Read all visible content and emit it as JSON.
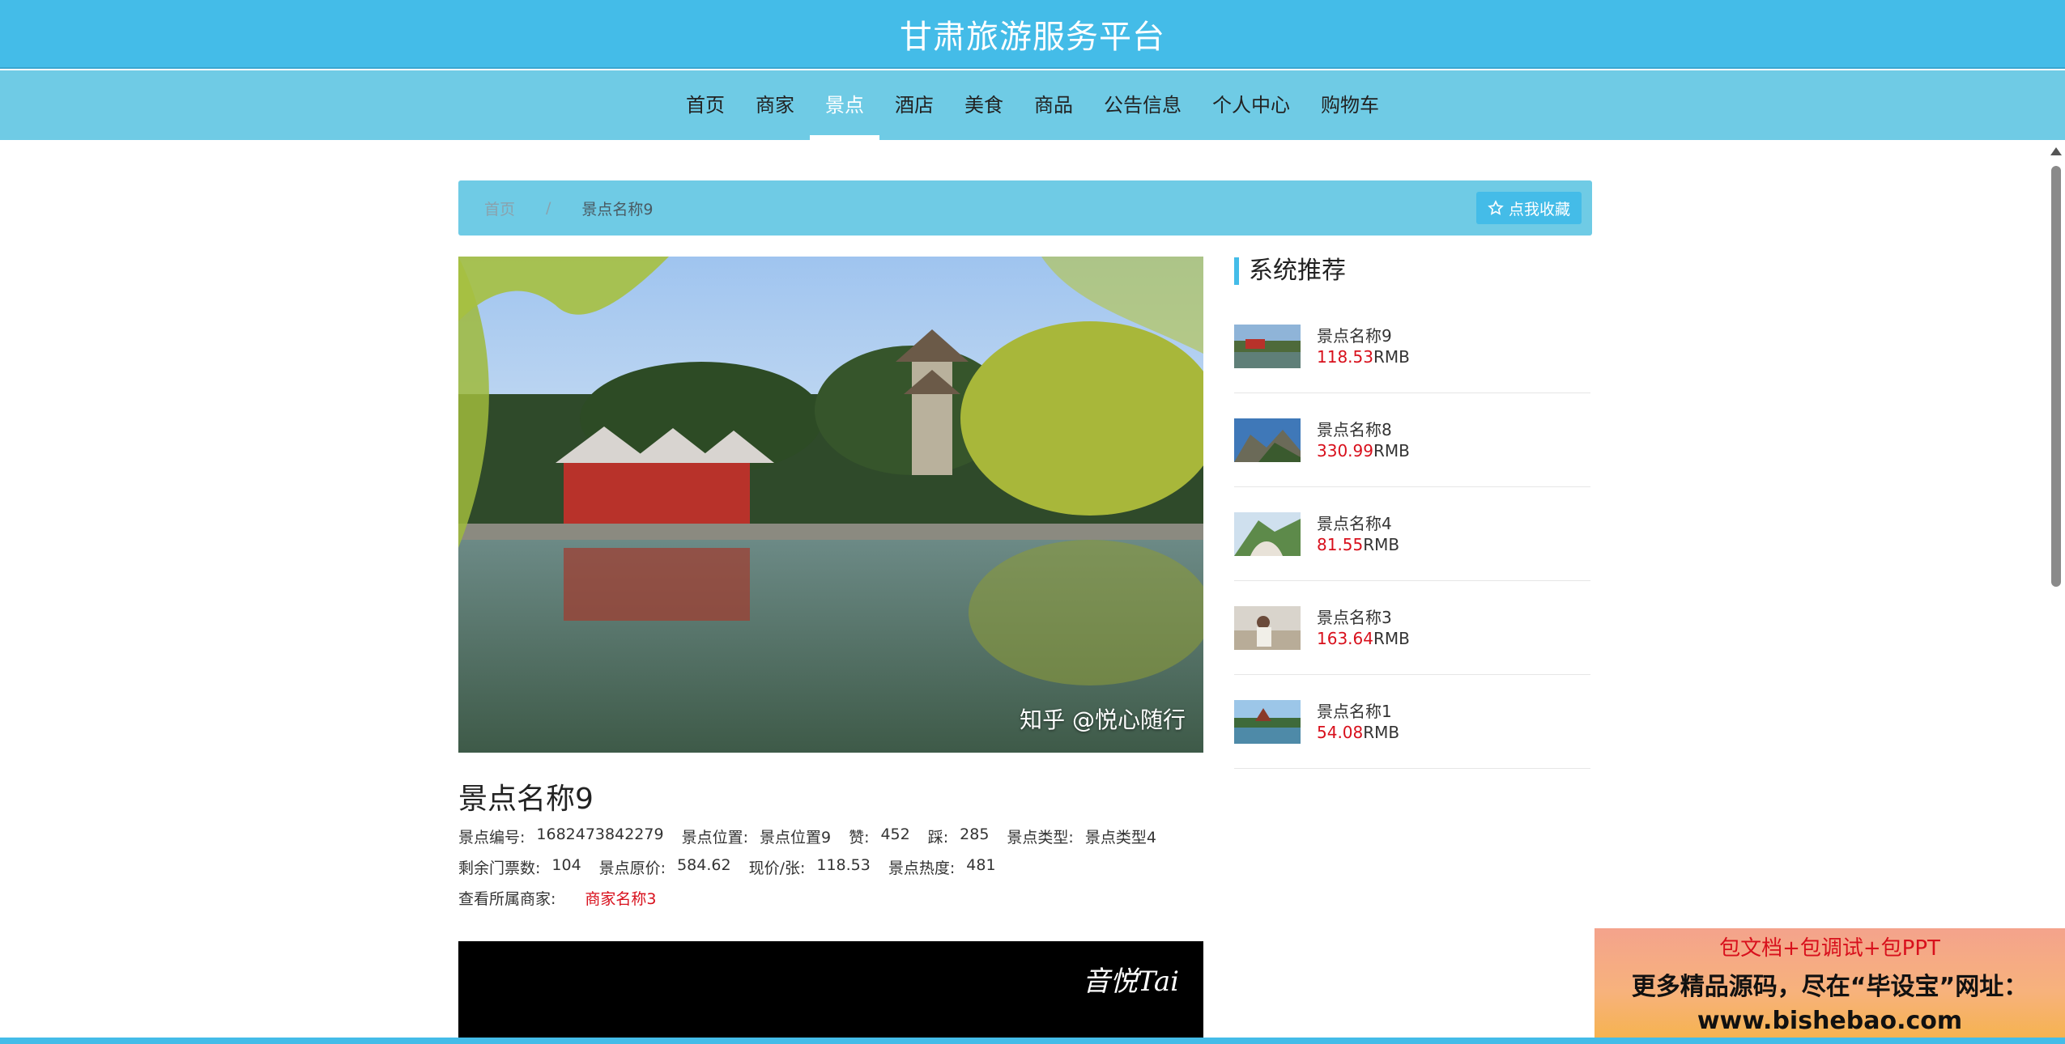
{
  "site": {
    "title": "甘肃旅游服务平台"
  },
  "nav": {
    "items": [
      "首页",
      "商家",
      "景点",
      "酒店",
      "美食",
      "商品",
      "公告信息",
      "个人中心",
      "购物车"
    ],
    "active_index": 2
  },
  "breadcrumb": {
    "home": "首页",
    "separator": "/",
    "current": "景点名称9",
    "favorite_label": "点我收藏"
  },
  "detail": {
    "title": "景点名称9",
    "watermark": "知乎 @悦心随行",
    "fields": {
      "code_label": "景点编号:",
      "code_value": "1682473842279",
      "location_label": "景点位置:",
      "location_value": "景点位置9",
      "like_label": "赞:",
      "like_value": "452",
      "dislike_label": "踩:",
      "dislike_value": "285",
      "type_label": "景点类型:",
      "type_value": "景点类型4",
      "tickets_label": "剩余门票数:",
      "tickets_value": "104",
      "orig_price_label": "景点原价:",
      "orig_price_value": "584.62",
      "cur_price_label": "现价/张:",
      "cur_price_value": "118.53",
      "heat_label": "景点热度:",
      "heat_value": "481",
      "merchant_label": "查看所属商家:",
      "merchant_value": "商家名称3"
    },
    "video_logo": "音悦Tai"
  },
  "recommend": {
    "title": "系统推荐",
    "items": [
      {
        "name": "景点名称9",
        "price": "118.53",
        "unit": "RMB"
      },
      {
        "name": "景点名称8",
        "price": "330.99",
        "unit": "RMB"
      },
      {
        "name": "景点名称4",
        "price": "81.55",
        "unit": "RMB"
      },
      {
        "name": "景点名称3",
        "price": "163.64",
        "unit": "RMB"
      },
      {
        "name": "景点名称1",
        "price": "54.08",
        "unit": "RMB"
      }
    ]
  },
  "ad": {
    "line1": "包文档+包调试+包PPT",
    "line2": "更多精品源码，尽在“毕设宝”网址：",
    "line3": "www.bishebao.com"
  },
  "colors": {
    "primary": "#44bce8",
    "nav_bg": "#6fcbe5",
    "price_red": "#d8101c"
  },
  "icons": [
    "star-icon"
  ]
}
